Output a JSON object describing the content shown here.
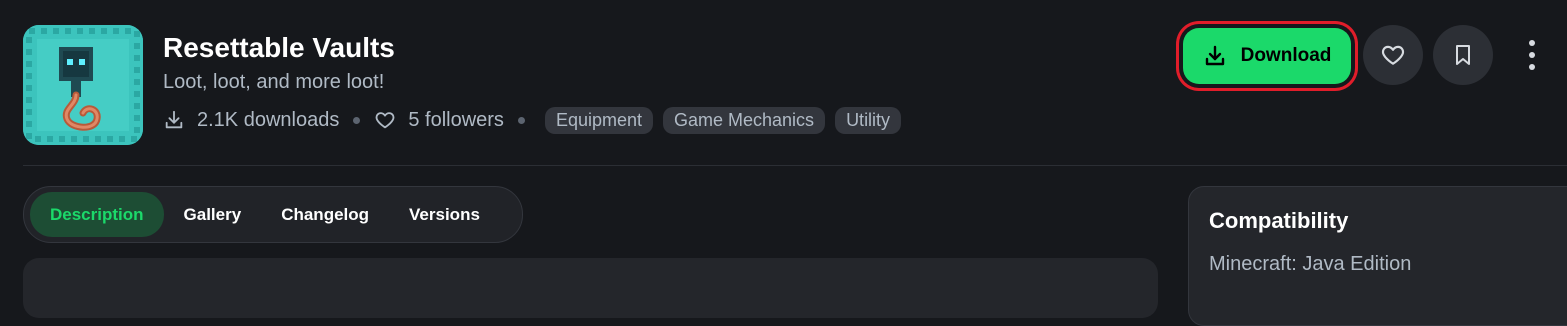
{
  "project": {
    "title": "Resettable Vaults",
    "tagline": "Loot, loot, and more loot!",
    "icon": "vault-key-icon"
  },
  "stats": {
    "downloads": "2.1K downloads",
    "followers": "5 followers"
  },
  "tags": [
    "Equipment",
    "Game Mechanics",
    "Utility"
  ],
  "actions": {
    "download_label": "Download",
    "follow_icon": "heart-icon",
    "bookmark_icon": "bookmark-icon",
    "more_icon": "more-vertical-icon"
  },
  "tabs": [
    {
      "label": "Description",
      "active": true
    },
    {
      "label": "Gallery",
      "active": false
    },
    {
      "label": "Changelog",
      "active": false
    },
    {
      "label": "Versions",
      "active": false
    }
  ],
  "compatibility": {
    "title": "Compatibility",
    "edition": "Minecraft: Java Edition"
  },
  "colors": {
    "background": "#16181c",
    "accent": "#1bd96a",
    "highlight_border": "#e11d2a",
    "muted_text": "#b0bac5"
  }
}
